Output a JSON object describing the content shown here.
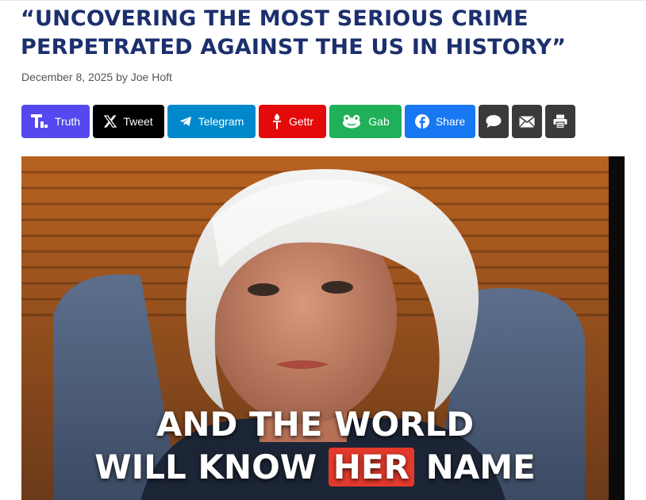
{
  "article": {
    "title_line1": "“UNCOVERING THE MOST SERIOUS CRIME",
    "title_line2": "PERPETRATED AGAINST THE US IN HISTORY”",
    "date": "December 8, 2025",
    "by": "by",
    "author": "Joe Hoft"
  },
  "share": {
    "truth": "Truth",
    "tweet": "Tweet",
    "telegram": "Telegram",
    "gettr": "Gettr",
    "gab": "Gab",
    "share": "Share"
  },
  "colors": {
    "headline": "#1c2f6e",
    "truth": "#5448ee",
    "tweet": "#000000",
    "telegram": "#0088cc",
    "gettr": "#e50a0a",
    "gab": "#21b05a",
    "facebook": "#1877f2",
    "gray": "#3a3a3a"
  },
  "hero": {
    "caption_line1": "AND THE WORLD",
    "caption_line2_pre": "WILL KNOW",
    "caption_highlight": "HER",
    "caption_line2_post": "NAME"
  }
}
